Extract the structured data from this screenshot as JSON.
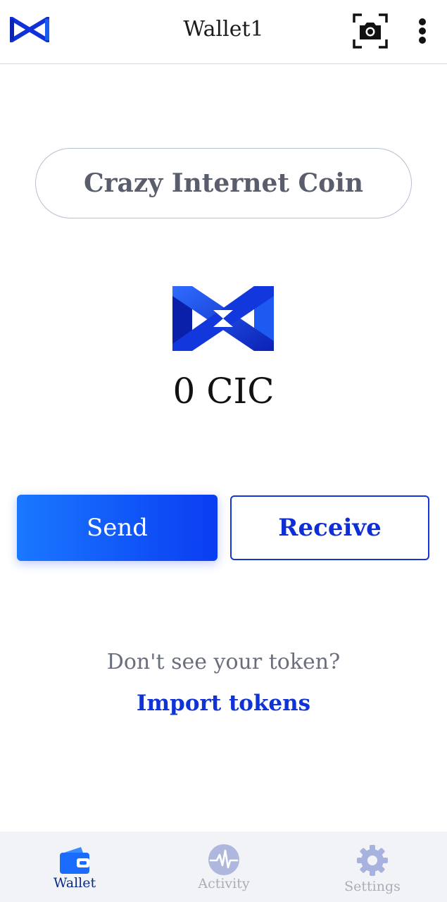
{
  "header": {
    "title": "Wallet1",
    "logo_icon": "cic-logo-icon",
    "scan_icon": "camera-scan-icon",
    "menu_icon": "kebab-menu-icon"
  },
  "network": {
    "name": "Crazy Internet Coin"
  },
  "balance": {
    "token_icon": "cic-token-logo-icon",
    "amount_text": "0 CIC"
  },
  "actions": {
    "send_label": "Send",
    "receive_label": "Receive"
  },
  "tokens": {
    "hint": "Don't see your token?",
    "import_label": "Import tokens"
  },
  "nav": {
    "items": [
      {
        "label": "Wallet",
        "icon": "wallet-icon",
        "active": true
      },
      {
        "label": "Activity",
        "icon": "activity-icon",
        "active": false
      },
      {
        "label": "Settings",
        "icon": "gear-icon",
        "active": false
      }
    ]
  },
  "colors": {
    "accent": "#0f33d6",
    "send_gradient_start": "#1a78ff",
    "send_gradient_end": "#0a3df2",
    "nav_bg": "#f2f3f7",
    "inactive": "#a9adb9"
  }
}
